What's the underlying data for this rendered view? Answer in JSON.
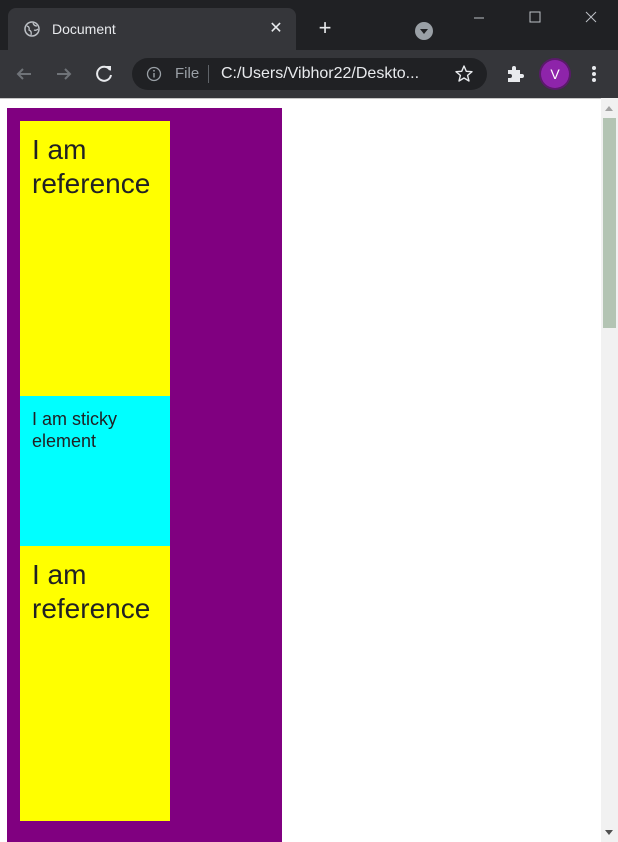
{
  "browser": {
    "tab_title": "Document",
    "tab_close_glyph": "✕",
    "new_tab_glyph": "+",
    "address": {
      "scheme_label": "File",
      "url": "C:/Users/Vibhor22/Deskto..."
    },
    "profile_initial": "V"
  },
  "page": {
    "ref_top_text": "I am reference",
    "sticky_text": "I am sticky element",
    "ref_bottom_text": "I am reference"
  },
  "colors": {
    "tabstrip": "#202124",
    "toolbar": "#35363a",
    "container": "#800080",
    "reference": "#ffff00",
    "sticky": "#00ffff",
    "avatar": "#8e24aa"
  },
  "icons": {
    "tab_favicon": "globe-icon",
    "back": "back-arrow-icon",
    "forward": "forward-arrow-icon",
    "reload": "reload-icon",
    "site_info": "info-icon",
    "bookmark": "star-icon",
    "extensions": "puzzle-icon",
    "menu": "kebab-menu-icon"
  }
}
